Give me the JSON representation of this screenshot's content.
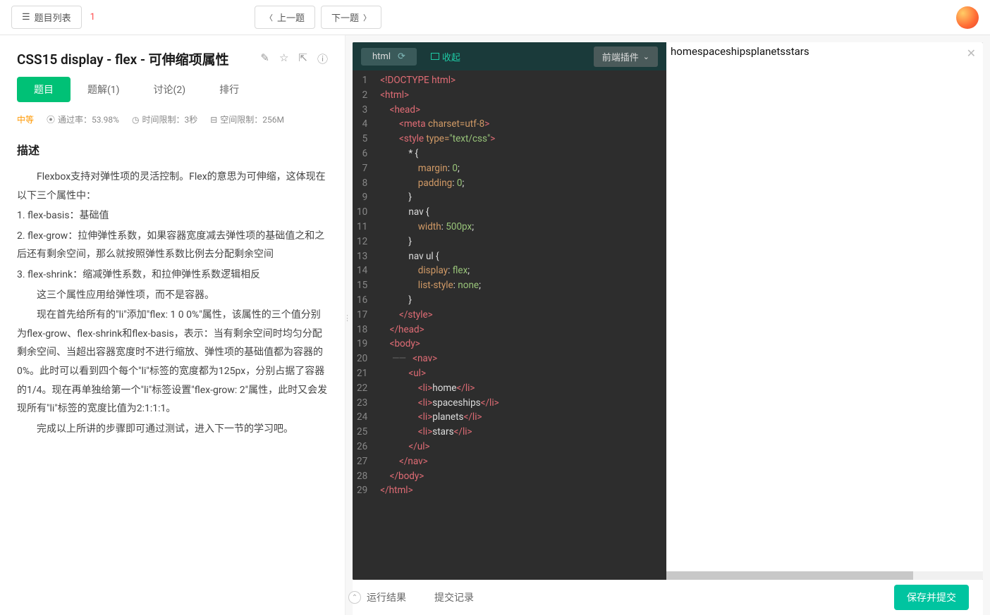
{
  "topbar": {
    "list_button": "题目列表",
    "badge": "1",
    "prev": "上一题",
    "next": "下一题"
  },
  "problem": {
    "title": "CSS15  display - flex - 可伸缩项属性",
    "tabs": {
      "t1": "题目",
      "t2": "题解(1)",
      "t3": "讨论(2)",
      "t4": "排行"
    },
    "meta": {
      "difficulty": "中等",
      "pass_rate_label": "通过率：53.98%",
      "time_limit_label": "时间限制：3秒",
      "space_limit_label": "空间限制：256M"
    },
    "section_title": "描述",
    "p1": "　　Flexbox支持对弹性项的灵活控制。Flex的意思为可伸缩，这体现在以下三个属性中：",
    "p2": "1. flex-basis：基础值",
    "p3": "2. flex-grow：拉伸弹性系数，如果容器宽度减去弹性项的基础值之和之后还有剩余空间，那么就按照弹性系数比例去分配剩余空间",
    "p4": "3. flex-shrink：缩减弹性系数，和拉伸弹性系数逻辑相反",
    "p5": "　　这三个属性应用给弹性项，而不是容器。",
    "p6": "　　现在首先给所有的\"li\"添加\"flex: 1 0 0%\"属性，该属性的三个值分别为flex-grow、flex-shrink和flex-basis，表示：当有剩余空间时均匀分配剩余空间、当超出容器宽度时不进行缩放、弹性项的基础值都为容器的0%。此时可以看到四个每个\"li\"标签的宽度都为125px，分别占据了容器的1/4。现在再单独给第一个\"li\"标签设置\"flex-grow: 2\"属性，此时又会发现所有\"li\"标签的宽度比值为2:1:1:1。",
    "p7": "　　完成以上所讲的步骤即可通过测试，进入下一节的学习吧。"
  },
  "editor": {
    "lang_tab": "html",
    "collapse": "收起",
    "plugins": "前端插件",
    "code_lines": [
      {
        "n": 1,
        "html": "<span class='tag'>&lt;!DOCTYPE html&gt;</span>"
      },
      {
        "n": 2,
        "html": "<span class='tag'>&lt;html&gt;</span>"
      },
      {
        "n": 3,
        "html": "    <span class='tag'>&lt;head&gt;</span>"
      },
      {
        "n": 4,
        "html": "        <span class='tag'>&lt;meta</span> <span class='attr'>charset=utf-8</span><span class='tag'>&gt;</span>"
      },
      {
        "n": 5,
        "html": "        <span class='tag'>&lt;style</span> <span class='attr'>type=</span><span class='str'>\"text/css\"</span><span class='tag'>&gt;</span>"
      },
      {
        "n": 6,
        "html": "            <span class='txt'>* {</span>"
      },
      {
        "n": 7,
        "html": "                <span class='attr'>margin</span>: <span class='str'>0</span>;"
      },
      {
        "n": 8,
        "html": "                <span class='attr'>padding</span>: <span class='str'>0</span>;"
      },
      {
        "n": 9,
        "html": "            <span class='txt'>}</span>"
      },
      {
        "n": 10,
        "html": "            <span class='txt'>nav {</span>"
      },
      {
        "n": 11,
        "html": "                <span class='attr'>width</span>: <span class='str'>500px</span>;"
      },
      {
        "n": 12,
        "html": "            <span class='txt'>}</span>"
      },
      {
        "n": 13,
        "html": "            <span class='txt'>nav ul {</span>"
      },
      {
        "n": 14,
        "html": "                <span class='attr'>display</span>: <span class='str'>flex</span>;"
      },
      {
        "n": 15,
        "html": "                <span class='attr'>list-style</span>: <span class='str'>none</span>;"
      },
      {
        "n": 16,
        "html": "            <span class='txt'>}</span>"
      },
      {
        "n": 17,
        "html": "        <span class='tag'>&lt;/style&gt;</span>"
      },
      {
        "n": 18,
        "html": "    <span class='tag'>&lt;/head&gt;</span>"
      },
      {
        "n": 19,
        "html": "    <span class='tag'>&lt;body&gt;</span>"
      },
      {
        "n": 20,
        "html": "     <span class='fold'>――</span>   <span class='tag'>&lt;nav&gt;</span>"
      },
      {
        "n": 21,
        "html": "            <span class='tag'>&lt;ul&gt;</span>"
      },
      {
        "n": 22,
        "html": "                <span class='tag'>&lt;li&gt;</span><span class='txt'>home</span><span class='tag'>&lt;/li&gt;</span>"
      },
      {
        "n": 23,
        "html": "                <span class='tag'>&lt;li&gt;</span><span class='txt'>spaceships</span><span class='tag'>&lt;/li&gt;</span>"
      },
      {
        "n": 24,
        "html": "                <span class='tag'>&lt;li&gt;</span><span class='txt'>planets</span><span class='tag'>&lt;/li&gt;</span>"
      },
      {
        "n": 25,
        "html": "                <span class='tag'>&lt;li&gt;</span><span class='txt'>stars</span><span class='tag'>&lt;/li&gt;</span>"
      },
      {
        "n": 26,
        "html": "            <span class='tag'>&lt;/ul&gt;</span>"
      },
      {
        "n": 27,
        "html": "        <span class='tag'>&lt;/nav&gt;</span>"
      },
      {
        "n": 28,
        "html": "    <span class='tag'>&lt;/body&gt;</span>"
      },
      {
        "n": 29,
        "html": "<span class='tag'>&lt;/html&gt;</span>"
      }
    ]
  },
  "preview_text": "homespaceshipsplanetsstars",
  "bottom": {
    "run_result": "运行结果",
    "submit_log": "提交记录",
    "submit_btn": "保存并提交"
  }
}
